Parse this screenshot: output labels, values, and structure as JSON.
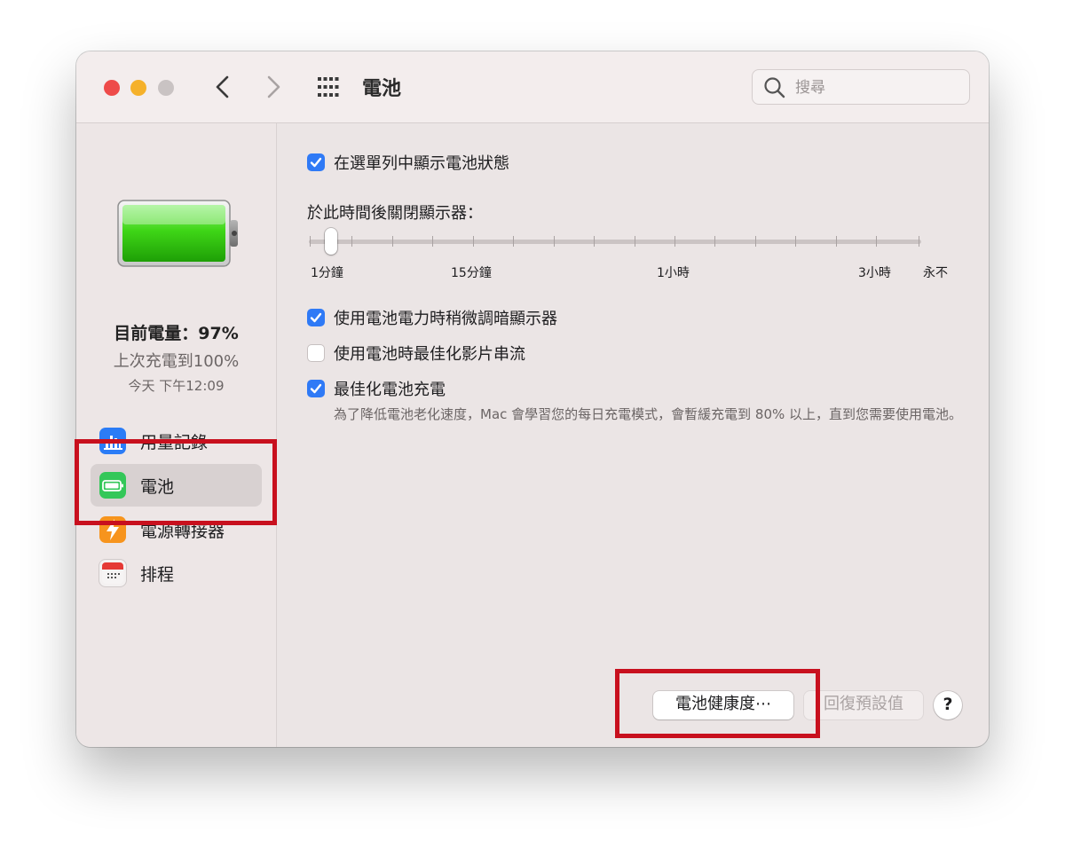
{
  "window": {
    "title": "電池",
    "search": {
      "placeholder": "搜尋"
    }
  },
  "sidebar": {
    "battery_level": "目前電量：97%",
    "last_charged": "上次充電到100%",
    "last_charged_time": "今天 下午12:09",
    "items": [
      {
        "label": "用量記錄",
        "icon": "bar-chart-icon",
        "color": "#2b7cf6"
      },
      {
        "label": "電池",
        "icon": "battery-icon",
        "color": "#34c759",
        "selected": true
      },
      {
        "label": "電源轉接器",
        "icon": "lightning-bolt-icon",
        "color": "#f7941d"
      },
      {
        "label": "排程",
        "icon": "calendar-icon",
        "color": "#e53935"
      }
    ]
  },
  "main": {
    "show_status": {
      "label": "在選單列中顯示電池狀態",
      "checked": true
    },
    "display_off": {
      "label": "於此時間後關閉顯示器：",
      "value": "1分鐘",
      "ticks": [
        "1分鐘",
        "15分鐘",
        "1小時",
        "3小時",
        "永不"
      ]
    },
    "dim_display": {
      "label": "使用電池電力時稍微調暗顯示器",
      "checked": true
    },
    "optimize_video": {
      "label": "使用電池時最佳化影片串流",
      "checked": false
    },
    "optimize_charging": {
      "label": "最佳化電池充電",
      "checked": true,
      "description": "為了降低電池老化速度，Mac 會學習您的每日充電模式，會暫緩充電到 80% 以上，直到您需要使用電池。"
    },
    "buttons": {
      "battery_health": "電池健康度⋯",
      "restore_defaults": "回復預設值",
      "help": "?"
    }
  },
  "colors": {
    "accent": "#2f7af6",
    "highlight": "#c8101e"
  }
}
